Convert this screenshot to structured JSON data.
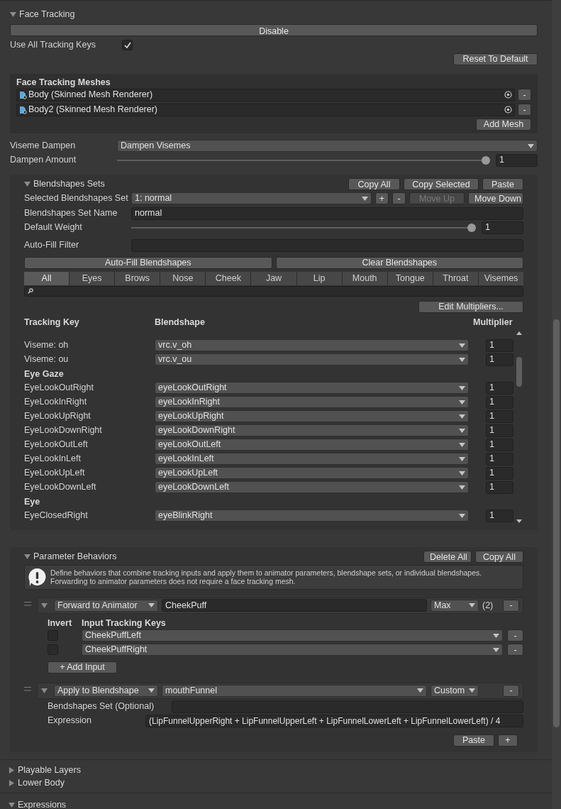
{
  "face_tracking": {
    "title": "Face Tracking",
    "expanded": true,
    "disable_button": "Disable",
    "use_all_keys": {
      "label": "Use All Tracking Keys",
      "checked": true
    },
    "reset_button": "Reset To Default",
    "meshes": {
      "title": "Face Tracking Meshes",
      "items": [
        {
          "name": "Body (Skinned Mesh Renderer)",
          "remove": "-"
        },
        {
          "name": "Body2 (Skinned Mesh Renderer)",
          "remove": "-"
        }
      ],
      "add_button": "Add Mesh"
    },
    "viseme_dampen": {
      "label": "Viseme Dampen",
      "value": "Dampen Visemes"
    },
    "dampen_amount": {
      "label": "Dampen Amount",
      "level": 1,
      "value": "1"
    }
  },
  "blendshapes_sets": {
    "title": "Blendshapes Sets",
    "expanded": true,
    "buttons": [
      "Copy All",
      "Copy Selected",
      "Paste"
    ],
    "selected_set": {
      "label": "Selected Blendshapes Set",
      "value": "1: normal"
    },
    "set_buttons": [
      {
        "label": "+",
        "disabled": false
      },
      {
        "label": "-",
        "disabled": false
      },
      {
        "label": "Move Up",
        "disabled": true
      },
      {
        "label": "Move Down",
        "disabled": false
      }
    ],
    "set_name": {
      "label": "Blendshapes Set Name",
      "value": "normal"
    },
    "default_weight": {
      "label": "Default Weight",
      "level": 1,
      "value": "1"
    },
    "filter": {
      "label": "Auto-Fill Filter"
    },
    "actions": [
      "Auto-Fill Blendshapes",
      "Clear Blendshapes"
    ],
    "tabs": [
      {
        "label": "All",
        "selected": true
      },
      {
        "label": "Eyes",
        "selected": false
      },
      {
        "label": "Brows",
        "selected": false
      },
      {
        "label": "Nose",
        "selected": false
      },
      {
        "label": "Cheek",
        "selected": false
      },
      {
        "label": "Jaw",
        "selected": false
      },
      {
        "label": "Lip",
        "selected": false
      },
      {
        "label": "Mouth",
        "selected": false
      },
      {
        "label": "Tongue",
        "selected": false
      },
      {
        "label": "Throat",
        "selected": false
      },
      {
        "label": "Visemes",
        "selected": false
      }
    ],
    "edit_multipliers": "Edit Multipliers...",
    "table": {
      "columns": [
        "Tracking Key",
        "Blendshape",
        "Multiplier"
      ],
      "rows": [
        {
          "kind": "row",
          "key": "Viseme: oh",
          "blendshape": "vrc.v_oh",
          "multiplier": "1"
        },
        {
          "kind": "row",
          "key": "Viseme: ou",
          "blendshape": "vrc.v_ou",
          "multiplier": "1"
        },
        {
          "kind": "group",
          "label": "Eye Gaze"
        },
        {
          "kind": "row",
          "key": "EyeLookOutRight",
          "blendshape": "eyeLookOutRight",
          "multiplier": "1"
        },
        {
          "kind": "row",
          "key": "EyeLookInRight",
          "blendshape": "eyeLookInRight",
          "multiplier": "1"
        },
        {
          "kind": "row",
          "key": "EyeLookUpRight",
          "blendshape": "eyeLookUpRight",
          "multiplier": "1"
        },
        {
          "kind": "row",
          "key": "EyeLookDownRight",
          "blendshape": "eyeLookDownRight",
          "multiplier": "1"
        },
        {
          "kind": "row",
          "key": "EyeLookOutLeft",
          "blendshape": "eyeLookOutLeft",
          "multiplier": "1"
        },
        {
          "kind": "row",
          "key": "EyeLookInLeft",
          "blendshape": "eyeLookInLeft",
          "multiplier": "1"
        },
        {
          "kind": "row",
          "key": "EyeLookUpLeft",
          "blendshape": "eyeLookUpLeft",
          "multiplier": "1"
        },
        {
          "kind": "row",
          "key": "EyeLookDownLeft",
          "blendshape": "eyeLookDownLeft",
          "multiplier": "1"
        },
        {
          "kind": "group",
          "label": "Eye"
        },
        {
          "kind": "row",
          "key": "EyeClosedRight",
          "blendshape": "eyeBlinkRight",
          "multiplier": "1"
        }
      ]
    }
  },
  "parameter_behaviors": {
    "title": "Parameter Behaviors",
    "expanded": true,
    "buttons": [
      "Delete All",
      "Copy All"
    ],
    "info": "Define behaviors that combine tracking inputs and apply them to animator parameters, blendshape sets, or individual blendshapes. Forwarding to animator parameters does not require a face tracking mesh.",
    "behaviors": [
      {
        "kind": "forward",
        "expanded": true,
        "mode": "Forward to Animator",
        "target": "CheekPuff",
        "reduce": "Max",
        "count": "(2)",
        "remove": "-",
        "invert_label": "Invert",
        "keys_label": "Input Tracking Keys",
        "inputs": [
          {
            "key": "CheekPuffLeft",
            "inverted": false,
            "remove": "-"
          },
          {
            "key": "CheekPuffRight",
            "inverted": false,
            "remove": "-"
          }
        ],
        "add_button": "+ Add Input"
      },
      {
        "kind": "apply",
        "expanded": true,
        "mode": "Apply to Blendshape",
        "target": "mouthFunnel",
        "reduce": "Custom",
        "remove": "-",
        "fields": [
          {
            "label": "Bendshapes Set (Optional)"
          },
          {
            "label": "Expression",
            "value": "(LipFunnelUpperRight + LipFunnelUpperLeft + LipFunnelLowerLeft + LipFunnelLowerLeft) / 4"
          }
        ]
      }
    ],
    "footer_buttons": [
      "Paste",
      "+"
    ]
  },
  "sections": [
    {
      "title": "Playable Layers",
      "expanded": false
    },
    {
      "title": "Lower Body",
      "expanded": false
    }
  ],
  "last_section": {
    "title": "Expressions",
    "expanded": true
  }
}
